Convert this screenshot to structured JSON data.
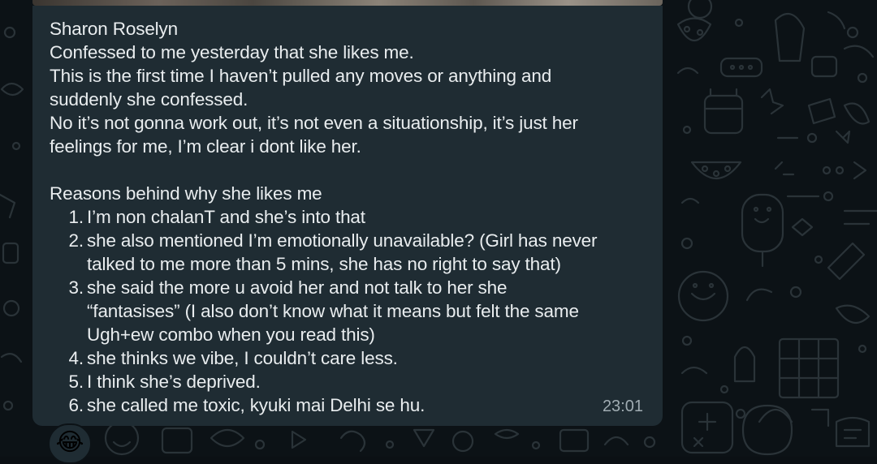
{
  "chat": {
    "message": {
      "sender": "Sharon Roselyn",
      "lines": [
        "Confessed to me yesterday that she likes me.",
        "This is the first time I haven’t pulled any moves or anything and",
        "suddenly she confessed.",
        "No it’s not gonna work out, it’s not even a situationship, it’s just her",
        "feelings for me, I’m clear i dont like her."
      ],
      "reasons_heading": "Reasons behind why she likes me",
      "reasons": [
        {
          "number": "1.",
          "lines": [
            "I’m non chalanT and she’s into that"
          ]
        },
        {
          "number": "2.",
          "lines": [
            "she also mentioned I’m emotionally unavailable? (Girl has never",
            "talked to me more than 5 mins, she has no right to say that)"
          ]
        },
        {
          "number": "3.",
          "lines": [
            "she said the more u avoid her and not talk to her she",
            "“fantasises” (I also don’t know what it means but felt the same",
            "Ugh+ew combo when you read this)"
          ]
        },
        {
          "number": "4.",
          "lines": [
            "she thinks we vibe, I couldn’t care less."
          ]
        },
        {
          "number": "5.",
          "lines": [
            "I think she’s deprived."
          ]
        },
        {
          "number": "6.",
          "lines": [
            "she called me toxic, kyuki mai Delhi se hu."
          ]
        }
      ],
      "time": "23:01",
      "reaction": "😂"
    }
  },
  "colors": {
    "background": "#0c1216",
    "bubble": "#1f2c33",
    "text": "#e9edef",
    "timestamp": "#a0acb2",
    "doodles": "#2a3338"
  },
  "icons": {
    "wallpaper": "doodle-pattern-icon",
    "reaction": "face-with-tears-of-joy"
  }
}
